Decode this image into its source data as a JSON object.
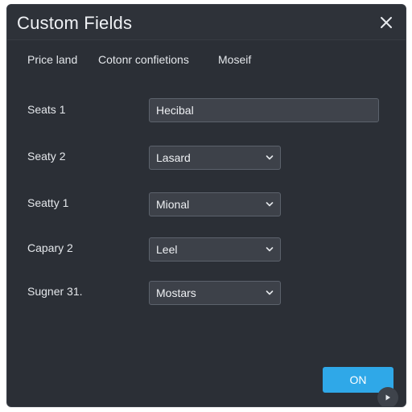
{
  "dialog": {
    "title": "Custom Fields",
    "close_icon": "close-icon"
  },
  "tabs": [
    {
      "label": "Price land"
    },
    {
      "label": "Cotonr confietions"
    },
    {
      "label": "Moseif"
    }
  ],
  "fields": [
    {
      "label": "Seats 1",
      "type": "text",
      "value": "Hecibal"
    },
    {
      "label": "Seaty 2",
      "type": "select",
      "value": "Lasard"
    },
    {
      "label": "Seatty 1",
      "type": "select",
      "value": "Mional"
    },
    {
      "label": "Capary 2",
      "type": "select",
      "value": "Leel"
    },
    {
      "label": "Sugner 31.",
      "type": "select",
      "value": "Mostars"
    }
  ],
  "actions": {
    "ok_label": "ON"
  },
  "colors": {
    "background": "#2b2f36",
    "accent": "#2fa8e8"
  }
}
